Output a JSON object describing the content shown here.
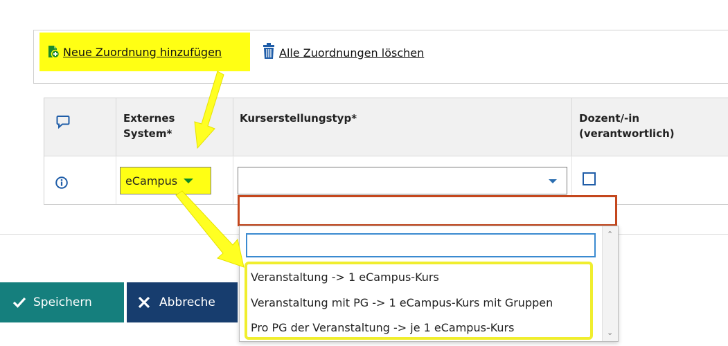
{
  "toolbar": {
    "add_label": "Neue Zuordnung hinzufügen",
    "delete_all_label": "Alle Zuordnungen löschen"
  },
  "table": {
    "headers": {
      "external_system": [
        "Externes",
        "System*"
      ],
      "course_type": "Kurserstellungstyp*",
      "lecturer": [
        "Dozent/-in",
        "(verantwortlich)"
      ]
    },
    "row": {
      "external_system_value": "eCampus",
      "course_type_value": "",
      "lecturer_checked": false
    }
  },
  "dropdown": {
    "search_value": "",
    "options": [
      "Veranstaltung -> 1 eCampus-Kurs",
      "Veranstaltung mit PG -> 1 eCampus-Kurs mit Gruppen",
      "Pro PG der Veranstaltung -> je 1 eCampus-Kurs"
    ]
  },
  "buttons": {
    "save_label": "Speichern",
    "cancel_label": "Abbreche"
  },
  "colors": {
    "highlight_yellow": "#ffff14",
    "annotation_arrow": "#f0ee2e",
    "focus_orange": "#c4471d",
    "save_teal": "#157f7d",
    "cancel_navy": "#173d6e",
    "link_blue": "#1f5da8"
  },
  "icons": {
    "add": "add-document-icon",
    "delete": "trash-icon",
    "comment": "speech-bubble-icon",
    "info": "info-circle-icon",
    "save": "checkmark-icon",
    "cancel": "close-icon"
  }
}
